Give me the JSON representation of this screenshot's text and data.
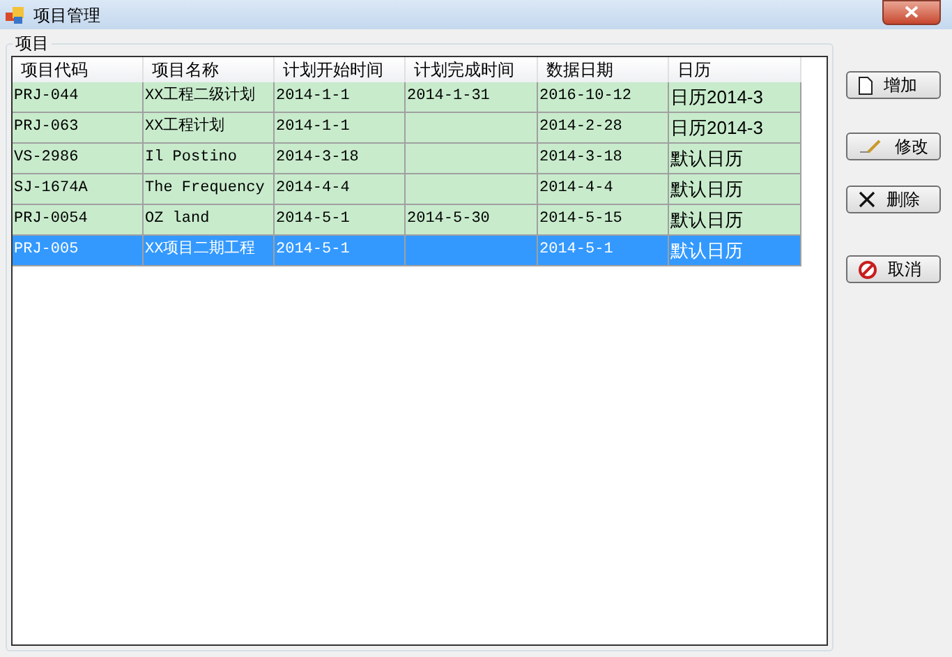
{
  "window": {
    "title": "项目管理"
  },
  "group": {
    "title": "项目"
  },
  "table": {
    "columns": [
      "项目代码",
      "项目名称",
      "计划开始时间",
      "计划完成时间",
      "数据日期",
      "日历"
    ],
    "rows": [
      {
        "cells": [
          "PRJ-044",
          "XX工程二级计划",
          "2014-1-1",
          "2014-1-31",
          "2016-10-12",
          "日历2014-3"
        ],
        "selected": false
      },
      {
        "cells": [
          "PRJ-063",
          "XX工程计划",
          "2014-1-1",
          "",
          "2014-2-28",
          "日历2014-3"
        ],
        "selected": false
      },
      {
        "cells": [
          "VS-2986",
          "Il Postino",
          "2014-3-18",
          "",
          "2014-3-18",
          "默认日历"
        ],
        "selected": false
      },
      {
        "cells": [
          "SJ-1674A",
          "The Frequency",
          "2014-4-4",
          "",
          "2014-4-4",
          "默认日历"
        ],
        "selected": false
      },
      {
        "cells": [
          "PRJ-0054",
          "OZ land",
          "2014-5-1",
          "2014-5-30",
          "2014-5-15",
          "默认日历"
        ],
        "selected": false
      },
      {
        "cells": [
          "PRJ-005",
          "XX项目二期工程",
          "2014-5-1",
          "",
          "2014-5-1",
          "默认日历"
        ],
        "selected": true
      }
    ]
  },
  "buttons": [
    {
      "label": "增加",
      "kind": "add"
    },
    {
      "label": "修改",
      "kind": "edit"
    },
    {
      "label": "删除",
      "kind": "delete"
    },
    {
      "label": "取消",
      "kind": "cancel"
    }
  ]
}
